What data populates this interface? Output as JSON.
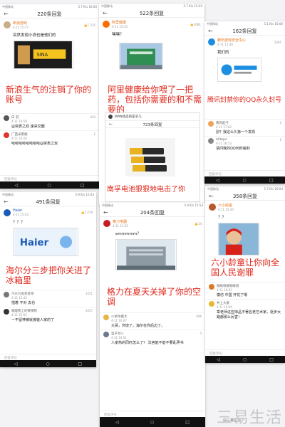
{
  "panels": [
    {
      "status_left": "中国移动",
      "status_right": "5.7 K/s 16:00",
      "header": "220条回复",
      "post_user": "新浪游戏",
      "post_time": "4-11 15:17",
      "post_likes": "1 235",
      "post_text": "突然发现小浪也是他们的",
      "caption": "新浪生气的注销了你的账号",
      "comments": [
        {
          "name": "白 羽",
          "time": "4-11 16:59",
          "text": "@突表之双 速来交圈",
          "likes": "450"
        },
        {
          "name": "广西米粥阁",
          "time": "4-11 16:20",
          "text": "哈哈哈哈哈哈哈哈@突表之双",
          "likes": "1"
        }
      ],
      "reply_placeholder": "回复评论"
    },
    {
      "status_left": "中国移动",
      "status_right": "5.7 K/s 15:50",
      "header": "522条回复",
      "post_user": "阿里健康",
      "post_time": "4-11 15:33",
      "post_likes": "3081",
      "post_text": "嘿嘿？",
      "caption": "阿里健康给你喂了一把药，包括你需要的和不需要的",
      "nested_header": "723条回复",
      "nested_user": "WAN动态的是子儿",
      "nested_caption": "南孚电池狠狠地电击了你"
    },
    {
      "status_left": "中国移动",
      "status_right": "5.1 K/s 16:00",
      "header": "162条回复",
      "post_user": "腾讯游戏安全中心",
      "post_time": "4-11 15:40",
      "post_likes": "3381",
      "post_text": "我们的",
      "caption": "腾讯封禁你的QQ永久封号",
      "comments": [
        {
          "name": "南风起兮",
          "time": "4-11 17:02",
          "text": "别？我这么久第一个发现",
          "likes": "2"
        },
        {
          "name": "Alitepe",
          "time": "4-11 16:13",
          "text": "请问我的QQ何时解封",
          "likes": "1"
        }
      ],
      "reply_placeholder": "回复评论"
    },
    {
      "status_left": "中国移动",
      "status_right": "5.9 K/s 15:43",
      "header": "491条回复",
      "post_user": "Haier",
      "post_time": "4-11 15:43",
      "post_likes": "1 279",
      "post_text": "？？？",
      "caption": "海尔分三步把你关进了冰箱里",
      "comments": [
        {
          "name": "汽水只会贫贫哥",
          "time": "4-11 15:43",
          "text": "插着 不对 去也",
          "likes": "1451"
        },
        {
          "name": "喵哩我上的黄铜院",
          "time": "4-11 16:02",
          "text": "一不留神被就被装人家的了",
          "likes": "1057"
        }
      ],
      "reply_placeholder": "回复评论"
    },
    {
      "status_left": "中国移动",
      "status_right": "5.9 K/s 15:54",
      "header": "204条回复",
      "post_user": "格力电器",
      "post_time": "4-11 15:55",
      "post_likes": "14",
      "post_text": "emmmmm？",
      "caption": "格力在夏天关掉了你的空调",
      "comments": [
        {
          "name": "小呆你最大",
          "time": "4-11 16:07",
          "text": "大哥，你饶了。海尔在你后边了。",
          "likes": "696"
        },
        {
          "name": "里子邓八",
          "time": "4-11 16:01",
          "text": "人家热的同时怎么了？ 法官能不能不要乱弄书",
          "likes": "5"
        }
      ],
      "reply_placeholder": "回复评论"
    },
    {
      "status_left": "中国移动",
      "status_right": "5.7 K/s 16:04",
      "header": "358条回复",
      "post_user": "六小龄童",
      "post_time": "4-11 15:45",
      "post_likes": "",
      "post_text": "？？",
      "caption": "六小龄童让你向全国人民谢罪",
      "comments": [
        {
          "name": "咖啡很顺咖啡很",
          "time": "4-11 16:03",
          "text": "模仿 中国 开花了嗯",
          "likes": ""
        },
        {
          "name": "井上大俊",
          "time": "4-11 16:06",
          "text": "章老师这些饰品不著名老艺术家，逐步大路都那么厉害！",
          "likes": ""
        }
      ],
      "reply_placeholder": "回复评论"
    }
  ],
  "watermark": {
    "small": "@三易生活",
    "big": "三易生活"
  }
}
